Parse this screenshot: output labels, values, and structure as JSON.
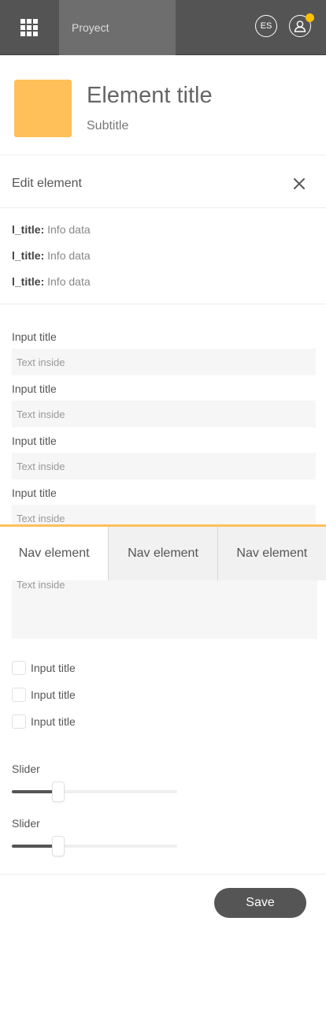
{
  "topbar": {
    "project_label": "Proyect",
    "lang_label": "ES",
    "notification_color": "#ffc000",
    "icons": [
      "apps-grid-icon",
      "user-icon"
    ]
  },
  "element": {
    "title": "Element title",
    "subtitle": "Subtitle",
    "thumb_color": "#ffc05a"
  },
  "edit": {
    "title": "Edit element"
  },
  "info": {
    "rows": [
      {
        "key": "l_title:",
        "value": "Info data"
      },
      {
        "key": "l_title:",
        "value": "Info data"
      },
      {
        "key": "l_title:",
        "value": "Info data"
      }
    ]
  },
  "inputs": [
    {
      "title": "Input title",
      "placeholder": "Text inside"
    },
    {
      "title": "Input title",
      "placeholder": "Text inside"
    },
    {
      "title": "Input title",
      "placeholder": "Text inside"
    },
    {
      "title": "Input title",
      "placeholder": "Text inside"
    }
  ],
  "nav": {
    "items": [
      "Nav element",
      "Nav element",
      "Nav element"
    ],
    "active_index": 0,
    "accent_color": "#ffc05a"
  },
  "textarea": {
    "placeholder": "Text inside"
  },
  "checkboxes": [
    {
      "label": "Input title",
      "checked": false
    },
    {
      "label": "Input title",
      "checked": false
    },
    {
      "label": "Input title",
      "checked": false
    }
  ],
  "sliders": [
    {
      "label": "Slider",
      "value": 0.28
    },
    {
      "label": "Slider",
      "value": 0.28
    }
  ],
  "footer": {
    "save_label": "Save"
  }
}
